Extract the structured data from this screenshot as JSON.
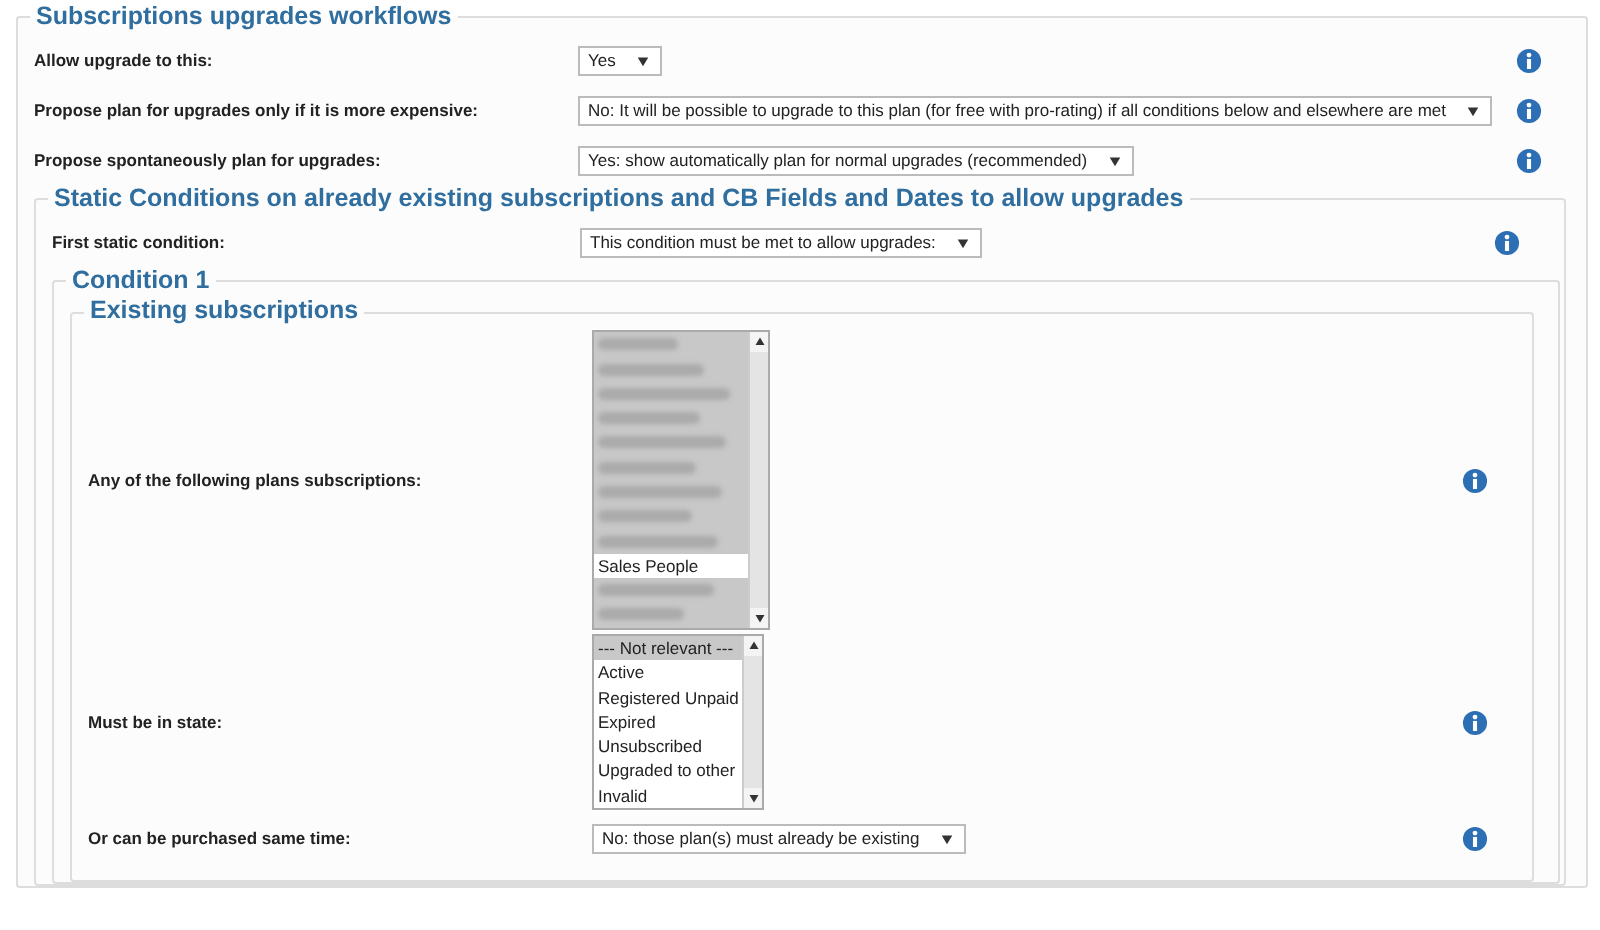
{
  "section": {
    "legend": "Subscriptions upgrades workflows",
    "fields": [
      {
        "label": "Allow upgrade to this:",
        "value": "Yes"
      },
      {
        "label": "Propose plan for upgrades only if it is more expensive:",
        "value": "No: It will be possible to upgrade to this plan (for free with pro-rating) if all conditions below and elsewhere are met"
      },
      {
        "label": "Propose spontaneously plan for upgrades:",
        "value": "Yes: show automatically plan for normal upgrades (recommended)"
      }
    ],
    "static_conditions": {
      "legend": "Static Conditions on already existing subscriptions and CB Fields and Dates to allow upgrades",
      "fields": [
        {
          "label": "First static condition:",
          "value": "This condition must be met to allow upgrades:"
        }
      ],
      "condition": {
        "legend": "Condition 1",
        "existing": {
          "legend": "Existing subscriptions",
          "plans": {
            "label": "Any of the following plans subscriptions:",
            "options": [
              {
                "redacted": true,
                "selected": true
              },
              {
                "redacted": true,
                "selected": true
              },
              {
                "redacted": true,
                "selected": true
              },
              {
                "redacted": true,
                "selected": true
              },
              {
                "redacted": true,
                "selected": true
              },
              {
                "redacted": true,
                "selected": true
              },
              {
                "redacted": true,
                "selected": true
              },
              {
                "redacted": true,
                "selected": true
              },
              {
                "redacted": true,
                "selected": true
              },
              {
                "text": "Sales People",
                "selected": false
              },
              {
                "redacted": true,
                "selected": true
              },
              {
                "redacted": true,
                "selected": true
              }
            ]
          },
          "states": {
            "label": "Must be in state:",
            "options": [
              {
                "text": "--- Not relevant ---",
                "selected": true
              },
              {
                "text": "Active",
                "selected": false
              },
              {
                "text": "Registered Unpaid",
                "selected": false
              },
              {
                "text": "Expired",
                "selected": false
              },
              {
                "text": "Unsubscribed",
                "selected": false
              },
              {
                "text": "Upgraded to other",
                "selected": false
              },
              {
                "text": "Invalid",
                "selected": false
              }
            ]
          },
          "purchase": {
            "label": "Or can be purchased same time:",
            "value": "No: those plan(s) must already be existing"
          }
        }
      }
    }
  }
}
